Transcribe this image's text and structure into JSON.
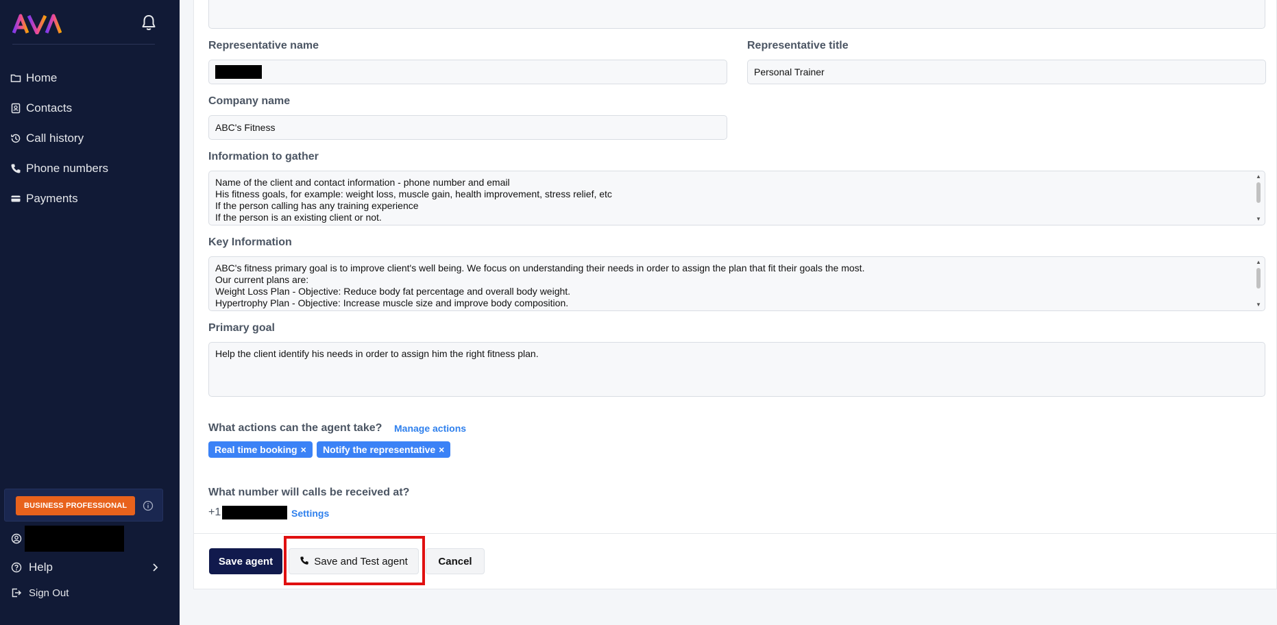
{
  "sidebar": {
    "logo_text": "AVA",
    "nav": [
      {
        "label": "Home",
        "icon": "folder-icon"
      },
      {
        "label": "Contacts",
        "icon": "contact-book-icon"
      },
      {
        "label": "Call history",
        "icon": "history-icon"
      },
      {
        "label": "Phone numbers",
        "icon": "phone-icon"
      },
      {
        "label": "Payments",
        "icon": "card-icon"
      }
    ],
    "plan_badge": "BUSINESS PROFESSIONAL",
    "help_label": "Help",
    "signout_label": "Sign Out"
  },
  "form": {
    "rep_name_label": "Representative name",
    "rep_title_label": "Representative title",
    "rep_title_value": "Personal Trainer",
    "company_label": "Company name",
    "company_value": "ABC's Fitness",
    "info_label": "Information to gather",
    "info_lines": [
      "Name of the client and contact information - phone number and email",
      "His fitness goals, for example: weight loss, muscle gain, health improvement, stress relief, etc",
      "If the person calling has any training experience",
      "If the person is an existing client or not."
    ],
    "key_label": "Key Information",
    "key_lines": [
      "ABC's fitness primary goal is to improve client's well being. We focus on understanding their needs in order to assign the plan that fit their goals the most.",
      "Our current plans are:",
      "Weight Loss Plan - Objective: Reduce body fat percentage and overall body weight.",
      "Hypertrophy Plan - Objective: Increase muscle size and improve body composition."
    ],
    "goal_label": "Primary goal",
    "goal_value": "Help the client identify his needs in order to assign him the right fitness plan.",
    "actions_label": "What actions can the agent take?",
    "manage_actions": "Manage actions",
    "chips": [
      {
        "label": "Real time booking"
      },
      {
        "label": "Notify the representative"
      }
    ],
    "chip_remove": "×",
    "number_label": "What number will calls be received at?",
    "number_prefix": "+1",
    "settings_link": "Settings"
  },
  "buttons": {
    "save": "Save agent",
    "save_test": "Save and Test agent",
    "cancel": "Cancel"
  },
  "colors": {
    "sidebar_bg": "#111a36",
    "primary_button": "#111a4d",
    "chip_bg": "#3b82f6",
    "link": "#2f80ed",
    "plan_badge": "#e8621c",
    "highlight": "#e01010"
  }
}
